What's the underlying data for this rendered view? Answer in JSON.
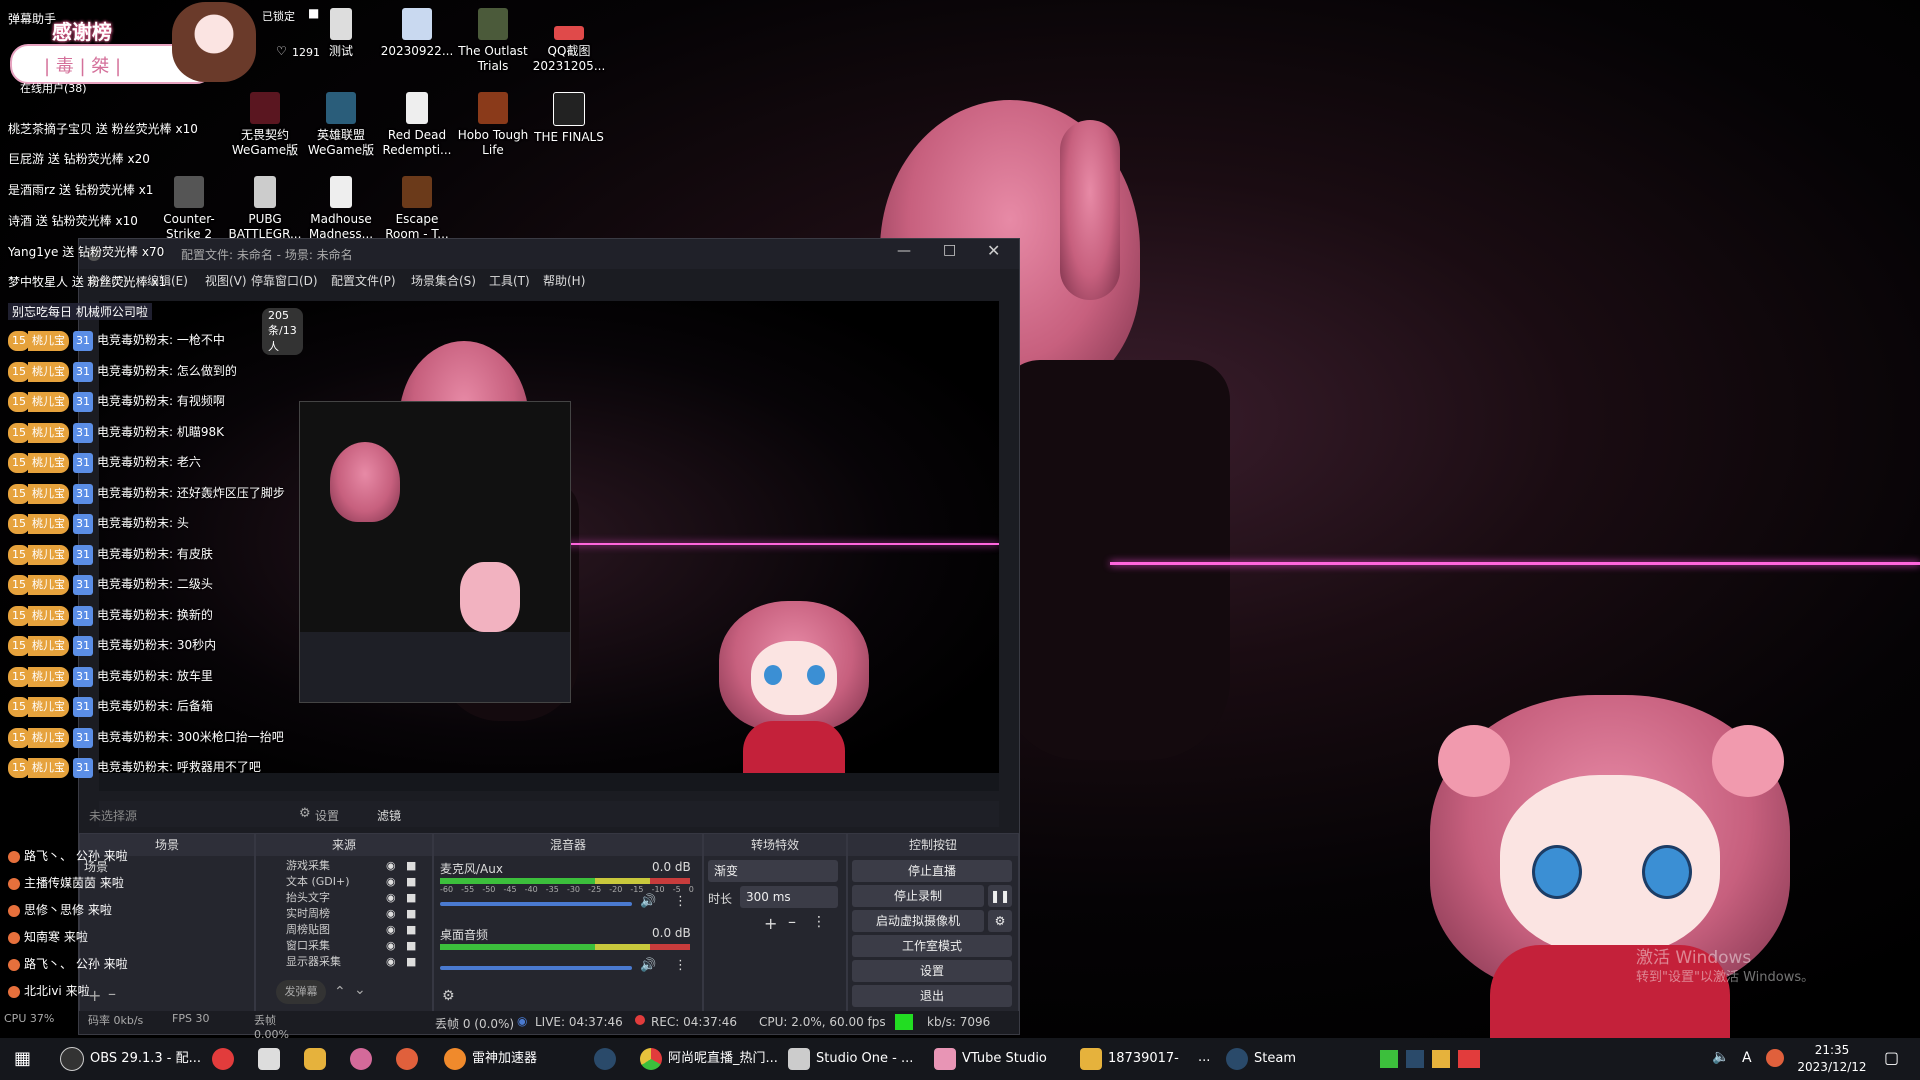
{
  "overlay": {
    "plugin_name": "弹幕助手",
    "thanks_title": "感谢榜",
    "thanks_names": "| 毒 | 桀 |",
    "locked_label": "已锁定",
    "likes": "1291",
    "online_label": "在线用户(38)",
    "gift_rows": [
      {
        "text": "桃芝茶摘子宝贝 送 粉丝荧光棒",
        "count": "x10"
      },
      {
        "text": "巨屁游 送 钻粉荧光棒",
        "count": "x20"
      },
      {
        "text": "是酒雨rz 送 钻粉荧光棒",
        "count": "x1"
      },
      {
        "text": "诗酒 送 钻粉荧光棒",
        "count": "x10"
      },
      {
        "text": "Yang1ye 送 钻粉荧光棒",
        "count": "x70"
      },
      {
        "text": "梦中牧星人 送 粉丝荧光棒",
        "count": "x1"
      }
    ],
    "notice": "别忘吃每日 机械师公司啦",
    "counter": "205条/13人",
    "chat_badge_level": "15",
    "chat_badge_name": "桃儿宝",
    "chat_fan_level": "31",
    "chat_messages": [
      "电竞毒奶粉末: 一枪不中",
      "电竞毒奶粉末: 怎么做到的",
      "电竞毒奶粉末: 有视频啊",
      "电竞毒奶粉末: 机瞄98K",
      "电竞毒奶粉末: 老六",
      "电竞毒奶粉末: 还好轰炸区压了脚步",
      "电竞毒奶粉末: 头",
      "电竞毒奶粉末: 有皮肤",
      "电竞毒奶粉末: 二级头",
      "电竞毒奶粉末: 换新的",
      "电竞毒奶粉末: 30秒内",
      "电竞毒奶粉末: 放车里",
      "电竞毒奶粉末: 后备箱",
      "电竞毒奶粉末: 300米枪口抬一抬吧",
      "电竞毒奶粉末: 呼救器用不了吧"
    ],
    "enter_rows": [
      {
        "name": "路飞丶、 公孙",
        "action": "来啦"
      },
      {
        "name": "主播传媒茵茵",
        "action": "来啦"
      },
      {
        "name": "思修丶思修",
        "action": "来啦"
      },
      {
        "name": "知南寒",
        "action": "来啦"
      },
      {
        "name": "路飞丶、 公孙",
        "action": "来啦"
      },
      {
        "name": "北北ivi",
        "action": "来啦"
      }
    ],
    "cpu": "CPU 37%",
    "bitrate": "码率 0kb/s",
    "fps": "FPS 30",
    "dropped": "丢帧 0.00%",
    "send_btn": "发弹幕"
  },
  "desktop_icons": [
    {
      "label": "测试"
    },
    {
      "label": "20230922..."
    },
    {
      "label": "The Outlast Trials"
    },
    {
      "label": "QQ截图 20231205..."
    },
    {
      "label": "无畏契约 WeGame版"
    },
    {
      "label": "英雄联盟 WeGame版"
    },
    {
      "label": "Red Dead Redempti..."
    },
    {
      "label": "Hobo Tough Life"
    },
    {
      "label": "THE FINALS"
    },
    {
      "label": "Counter-Strike 2"
    },
    {
      "label": "PUBG BATTLEGR..."
    },
    {
      "label": "Madhouse Madness..."
    },
    {
      "label": "Escape Room - T..."
    }
  ],
  "obs": {
    "title": "配置文件: 未命名 - 场景: 未命名",
    "menu": [
      "文件(F)",
      "编辑(E)",
      "视图(V)",
      "停靠窗口(D)",
      "配置文件(P)",
      "场景集合(S)",
      "工具(T)",
      "帮助(H)"
    ],
    "preview_btns": {
      "properties": "设置",
      "filters": "滤镜"
    },
    "no_source": "未选择源",
    "docks": {
      "scenes": {
        "title": "场景",
        "item": "场景"
      },
      "sources": {
        "title": "来源",
        "items": [
          "游戏采集",
          "文本 (GDI+)",
          "抬头文字",
          "实时周榜",
          "周榜贴图",
          "窗口采集",
          "显示器采集"
        ]
      },
      "mixer": {
        "title": "混音器",
        "channels": [
          {
            "name": "麦克风/Aux",
            "db": "0.0 dB"
          },
          {
            "name": "桌面音频",
            "db": "0.0 dB"
          }
        ],
        "ticks": [
          "-60",
          "-55",
          "-50",
          "-45",
          "-40",
          "-35",
          "-30",
          "-25",
          "-20",
          "-15",
          "-10",
          "-5",
          "0"
        ]
      },
      "transitions": {
        "title": "转场特效",
        "type": "渐变",
        "duration_label": "时长",
        "duration": "300 ms"
      },
      "controls": {
        "title": "控制按钮",
        "buttons": [
          "停止直播",
          "停止录制",
          "启动虚拟摄像机",
          "工作室模式",
          "设置",
          "退出"
        ]
      }
    },
    "status": {
      "dropped": "丢帧 0 (0.0%)",
      "live": "LIVE: 04:37:46",
      "rec": "REC: 04:37:46",
      "cpu": "CPU: 2.0%, 60.00 fps",
      "kbs": "kb/s: 7096"
    }
  },
  "watermark": {
    "line1": "激活 Windows",
    "line2": "转到\"设置\"以激活 Windows。"
  },
  "taskbar": {
    "items": [
      {
        "label": "OBS 29.1.3 - 配..."
      },
      {
        "label": "雷神加速器"
      },
      {
        "label": "阿尚呢直播_热门..."
      },
      {
        "label": "Studio One - ..."
      },
      {
        "label": "VTube Studio"
      },
      {
        "label": "18739017-"
      },
      {
        "label": "Steam"
      }
    ],
    "overflow": "...",
    "tray_lang": "A",
    "time": "21:35",
    "date": "2023/12/12"
  },
  "colors": {
    "accent_pink": "#ff66dd",
    "live_green": "#22dd22",
    "rec_red": "#e23c3c"
  }
}
